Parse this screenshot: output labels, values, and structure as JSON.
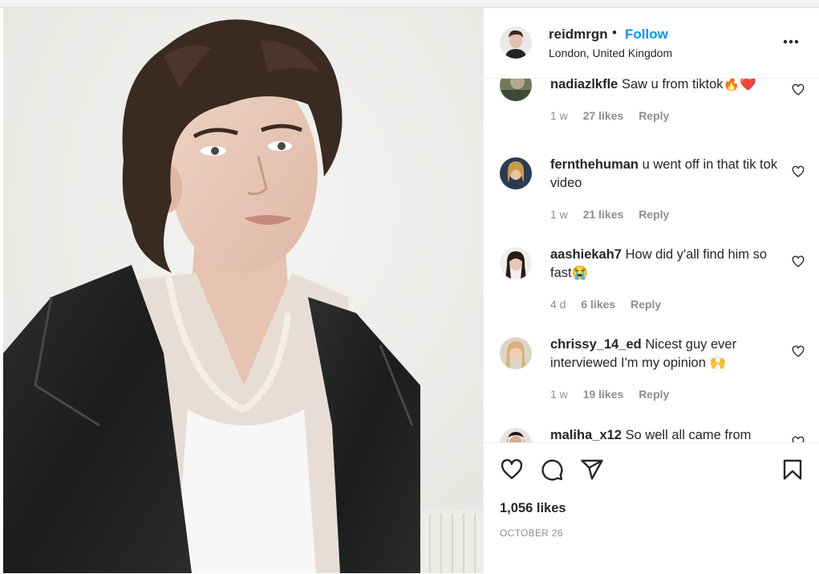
{
  "post": {
    "username": "reidmrgn",
    "separator": "•",
    "follow_label": "Follow",
    "location": "London, United Kingdom",
    "likes": "1,056 likes",
    "date": "OCTOBER 26"
  },
  "comments": [
    {
      "user": "nadiazlkfle",
      "text": "Saw u from tiktok🔥❤️",
      "time": "1 w",
      "likes": "27 likes",
      "reply": "Reply"
    },
    {
      "user": "fernthehuman",
      "text": "u went off in that tik tok video",
      "time": "1 w",
      "likes": "21 likes",
      "reply": "Reply"
    },
    {
      "user": "aashiekah7",
      "text": "How did y'all find him so fast😭",
      "time": "4 d",
      "likes": "6 likes",
      "reply": "Reply"
    },
    {
      "user": "chrissy_14_ed",
      "text": "Nicest guy ever interviewed I'm my opinion 🙌",
      "time": "1 w",
      "likes": "19 likes",
      "reply": "Reply"
    },
    {
      "user": "maliha_x12",
      "text": "So well all came from",
      "time": "",
      "likes": "",
      "reply": ""
    }
  ],
  "icons": {
    "more": "more-options-icon",
    "like": "heart-icon",
    "comment": "comment-icon",
    "share": "share-icon",
    "save": "bookmark-icon"
  },
  "colors": {
    "follow": "#0095f6",
    "text": "#262626",
    "secondary": "#8e8e8e"
  }
}
